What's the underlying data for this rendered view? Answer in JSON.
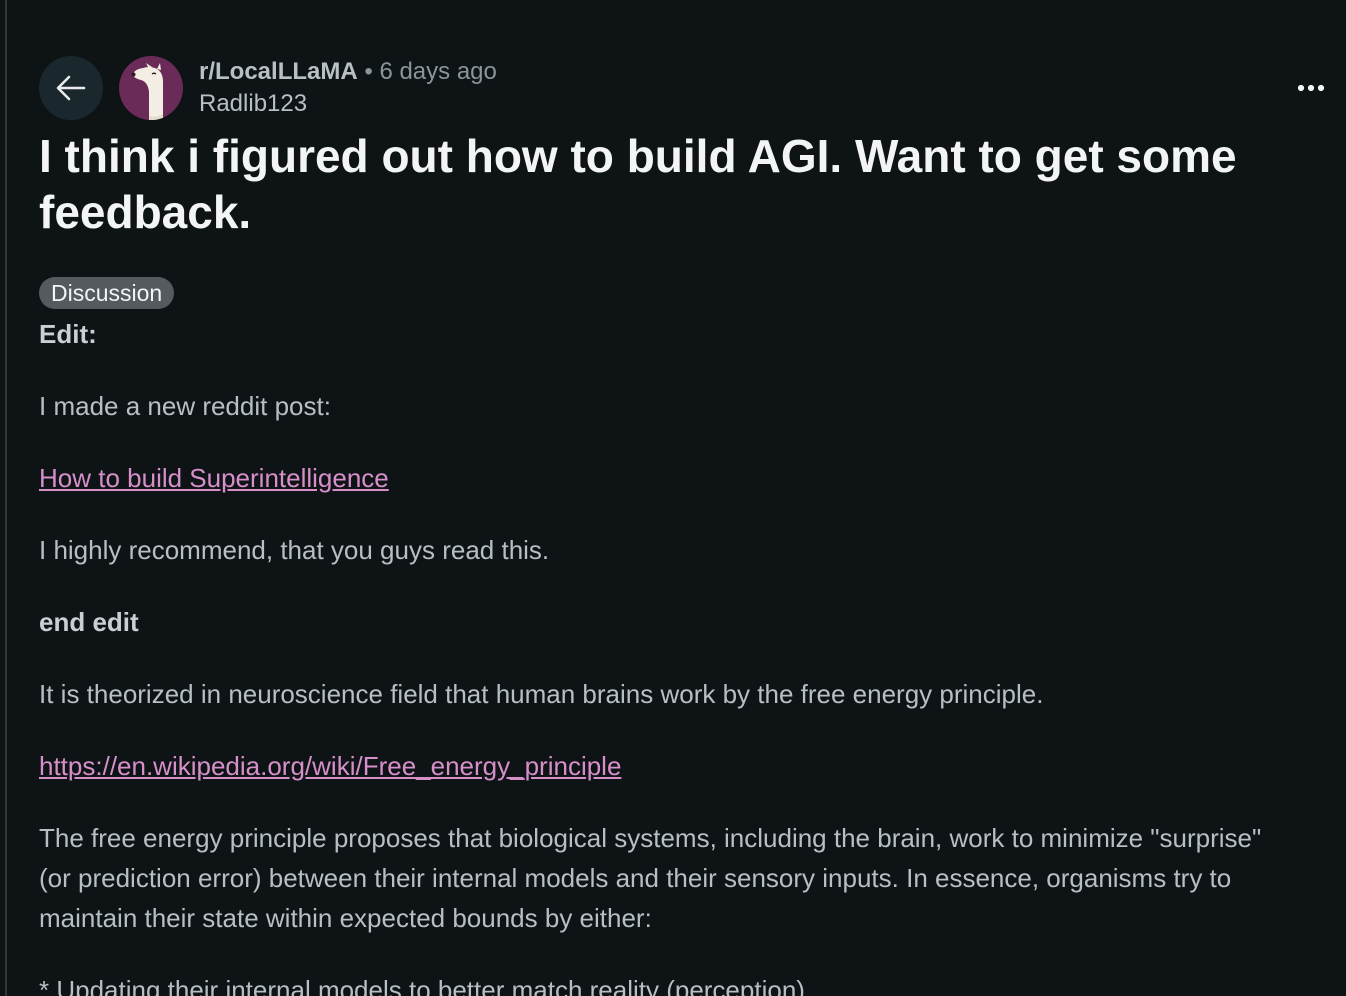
{
  "header": {
    "subreddit": "r/LocalLLaMA",
    "separator": "•",
    "time_ago": "6 days ago",
    "username": "Radlib123"
  },
  "post": {
    "title": "I think i figured out how to build AGI. Want to get some feedback.",
    "flair": "Discussion",
    "edit_heading": "Edit:",
    "edit_text": "I made a new reddit post:",
    "edit_link": "How to build Superintelligence",
    "recommend_text": "I highly recommend, that you guys read this.",
    "end_edit": "end edit",
    "paragraph_1": "It is theorized in neuroscience field that human brains work by the free energy principle.",
    "wiki_link": "https://en.wikipedia.org/wiki/Free_energy_principle",
    "paragraph_2": "The free energy principle proposes that biological systems, including the brain, work to minimize \"surprise\" (or prediction error) between their internal models and their sensory inputs. In essence, organisms try to maintain their state within expected bounds by either:",
    "bullet_1": "* Updating their internal models to better match reality (perception)"
  },
  "colors": {
    "background": "#0e1416",
    "link": "#d68fc9",
    "avatar_bg": "#6b2b59",
    "flair_bg": "#545a5e"
  },
  "icons": [
    "back-arrow-icon",
    "snoo-avatar-icon",
    "more-options-icon"
  ]
}
